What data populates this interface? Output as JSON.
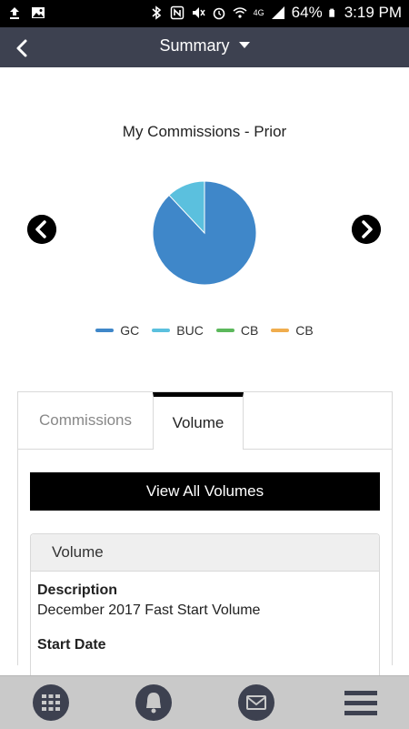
{
  "status_bar": {
    "battery": "64%",
    "time": "3:19 PM",
    "network": "4G"
  },
  "header": {
    "title": "Summary"
  },
  "chart_data": {
    "type": "pie",
    "title": "My Commissions - Prior",
    "categories": [
      "GC",
      "BUC",
      "CB",
      "CB"
    ],
    "values": [
      88,
      12,
      0,
      0
    ],
    "colors": [
      "#3f87c9",
      "#5bc0de",
      "#5cb85c",
      "#f0ad4e"
    ],
    "legend": "bottom"
  },
  "tabs": [
    {
      "label": "Commissions"
    },
    {
      "label": "Volume"
    }
  ],
  "view_button_label": "View All Volumes",
  "panel": {
    "title": "Volume",
    "description_label": "Description",
    "description_value": "December 2017 Fast Start Volume",
    "start_date_label": "Start Date"
  },
  "icons": {
    "back": "chevron-left-icon",
    "prev": "prev-arrow-icon",
    "next": "next-arrow-icon",
    "nav": [
      "grid-icon",
      "bell-icon",
      "mail-icon",
      "menu-icon"
    ]
  }
}
